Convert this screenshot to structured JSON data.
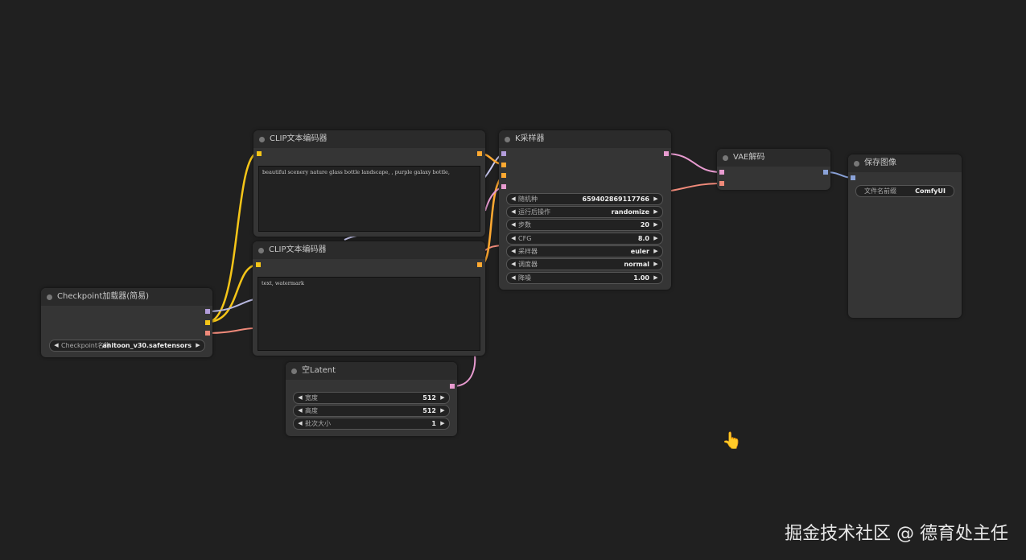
{
  "colors": {
    "background": "#202020",
    "clip_wire": "#f5c518",
    "model_wire": "#b39ddb",
    "vae_wire": "#f08a7a",
    "latent_wire": "#e89bd0",
    "conditioning_wire": "#ffa931",
    "image_wire": "#8aa2d8"
  },
  "nodes": {
    "clip_encoder_pos": {
      "title": "CLIP文本编码器",
      "text": "beautiful scenery nature glass bottle landscape, , purple galaxy bottle,"
    },
    "clip_encoder_neg": {
      "title": "CLIP文本编码器",
      "text": "text, watermark"
    },
    "checkpoint_loader": {
      "title": "Checkpoint加载器(简易)",
      "widget": {
        "label": "Checkpoint名称",
        "value": "anitoon_v30.safetensors"
      }
    },
    "ksampler": {
      "title": "K采样器",
      "widgets": [
        {
          "label": "随机种",
          "value": "659402869117766"
        },
        {
          "label": "运行后操作",
          "value": "randomize"
        },
        {
          "label": "步数",
          "value": "20"
        },
        {
          "label": "CFG",
          "value": "8.0"
        },
        {
          "label": "采样器",
          "value": "euler"
        },
        {
          "label": "调度器",
          "value": "normal"
        },
        {
          "label": "降噪",
          "value": "1.00"
        }
      ]
    },
    "vae_decode": {
      "title": "VAE解码"
    },
    "save_image": {
      "title": "保存图像",
      "widget": {
        "label": "文件名前缀",
        "value": "ComfyUI"
      }
    },
    "empty_latent": {
      "title": "空Latent",
      "widgets": [
        {
          "label": "宽度",
          "value": "512"
        },
        {
          "label": "高度",
          "value": "512"
        },
        {
          "label": "批次大小",
          "value": "1"
        }
      ]
    }
  },
  "watermark": "掘金技术社区 @ 德育处主任",
  "cursor_icon": "hand-pointer"
}
